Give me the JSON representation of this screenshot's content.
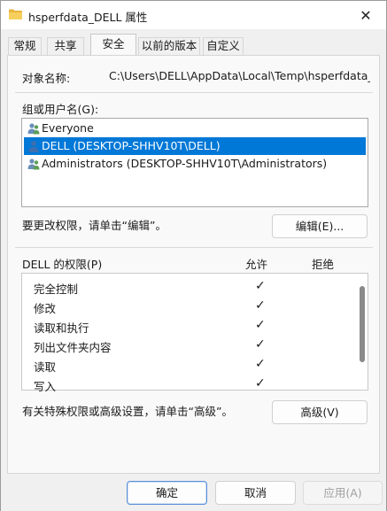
{
  "window": {
    "title": "hsperfdata_DELL 属性",
    "close_glyph": "✕"
  },
  "tabs": [
    {
      "label": "常规"
    },
    {
      "label": "共享"
    },
    {
      "label": "安全"
    },
    {
      "label": "以前的版本"
    },
    {
      "label": "自定义"
    }
  ],
  "security": {
    "object_name_label": "对象名称:",
    "object_name_value": "C:\\Users\\DELL\\AppData\\Local\\Temp\\hsperfdata_DE",
    "group_label": "组或用户名(G):",
    "users": [
      {
        "name": "Everyone",
        "icon": "users-group-icon"
      },
      {
        "name": "DELL (DESKTOP-SHHV10T\\DELL)",
        "icon": "user-icon",
        "selected": true
      },
      {
        "name": "Administrators (DESKTOP-SHHV10T\\Administrators)",
        "icon": "users-group-icon"
      }
    ],
    "change_hint": "要更改权限，请单击“编辑”。",
    "edit_button": "编辑(E)...",
    "perm_header": "DELL 的权限(P)",
    "allow_header": "允许",
    "deny_header": "拒绝",
    "permissions": [
      {
        "name": "完全控制",
        "allow": "✓"
      },
      {
        "name": "修改",
        "allow": "✓"
      },
      {
        "name": "读取和执行",
        "allow": "✓"
      },
      {
        "name": "列出文件夹内容",
        "allow": "✓"
      },
      {
        "name": "读取",
        "allow": "✓"
      },
      {
        "name": "写入",
        "allow": "✓"
      }
    ],
    "advanced_hint": "有关特殊权限或高级设置，请单击“高级”。",
    "advanced_button": "高级(V)"
  },
  "footer": {
    "ok": "确定",
    "cancel": "取消",
    "apply": "应用(A)"
  },
  "colors": {
    "selection": "#0078d7",
    "folder": "#f2c14e"
  }
}
